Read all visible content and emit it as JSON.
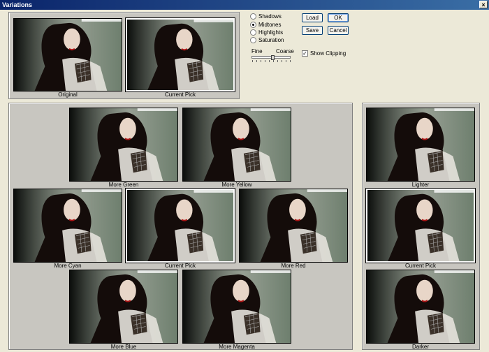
{
  "window": {
    "title": "Variations",
    "close_symbol": "×"
  },
  "top": {
    "original": {
      "caption": "Original",
      "tint": "#6e7f6e"
    },
    "current": {
      "caption": "Current Pick",
      "tint": "#6f8070"
    }
  },
  "radio_options": [
    {
      "label": "Shadows",
      "selected": false
    },
    {
      "label": "Midtones",
      "selected": true
    },
    {
      "label": "Highlights",
      "selected": false
    },
    {
      "label": "Saturation",
      "selected": false
    }
  ],
  "slider": {
    "fine_label": "Fine",
    "coarse_label": "Coarse",
    "value_fraction": 0.55
  },
  "show_clipping": {
    "label": "Show Clipping",
    "checked": true
  },
  "buttons": {
    "load": "Load",
    "ok": "OK",
    "save": "Save",
    "cancel": "Cancel"
  },
  "variations": {
    "more_green": {
      "caption": "More Green",
      "tint": "#5f8f4f"
    },
    "more_yellow": {
      "caption": "More Yellow",
      "tint": "#8f8f55"
    },
    "more_cyan": {
      "caption": "More Cyan",
      "tint": "#5a8a80"
    },
    "current": {
      "caption": "Current Pick",
      "tint": "#6f8070"
    },
    "more_red": {
      "caption": "More Red",
      "tint": "#8f6050"
    },
    "more_blue": {
      "caption": "More Blue",
      "tint": "#5a6f90"
    },
    "more_magenta": {
      "caption": "More Magenta",
      "tint": "#85607a"
    }
  },
  "lightness": {
    "lighter": {
      "caption": "Lighter",
      "tint": "#8a9a8a"
    },
    "current": {
      "caption": "Current Pick",
      "tint": "#6f8070"
    },
    "darker": {
      "caption": "Darker",
      "tint": "#4f5f50"
    }
  }
}
